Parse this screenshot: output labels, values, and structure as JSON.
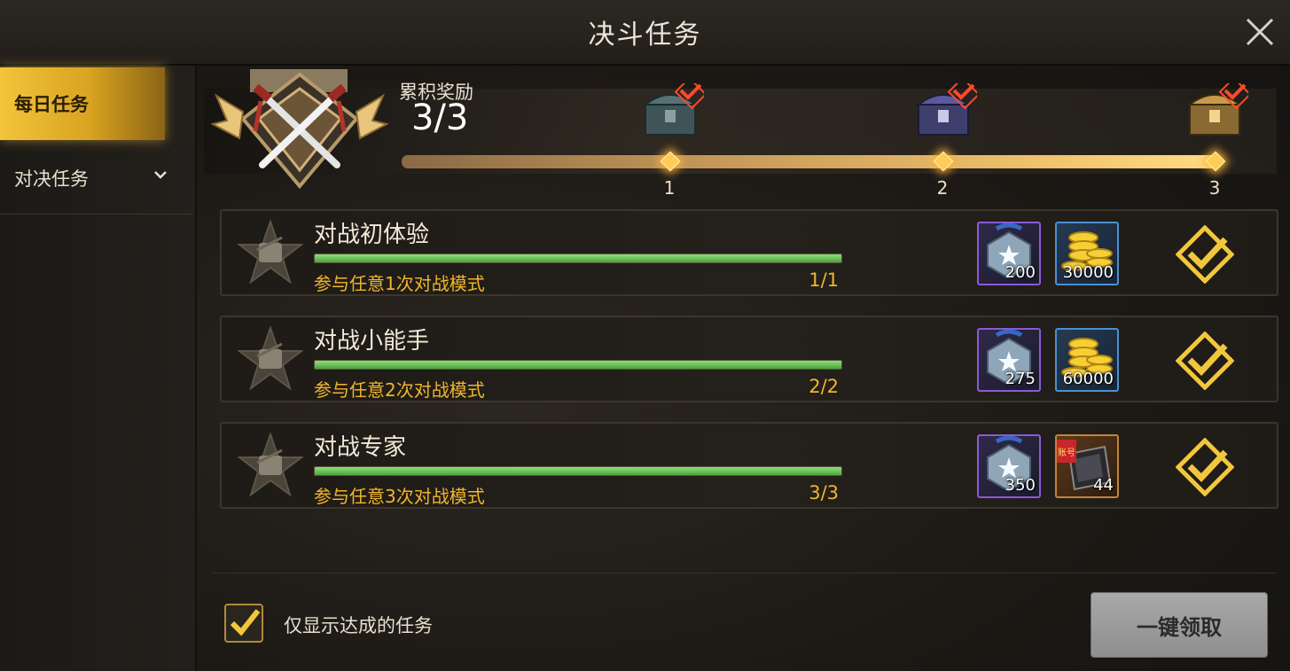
{
  "header": {
    "title": "决斗任务"
  },
  "sidebar": {
    "tabs": [
      {
        "label": "每日任务"
      },
      {
        "label": "对决任务"
      }
    ]
  },
  "rewards": {
    "label": "累积奖励",
    "progress_text": "3/3",
    "progress_fraction": 1.0,
    "milestones": [
      {
        "number": "1",
        "chest": "teal-chest-icon",
        "claimed": true
      },
      {
        "number": "2",
        "chest": "purple-chest-icon",
        "claimed": true
      },
      {
        "number": "3",
        "chest": "gold-chest-icon",
        "claimed": true
      }
    ]
  },
  "tasks": [
    {
      "name": "对战初体验",
      "description": "参与任意1次对战模式",
      "progress": "1/1",
      "fraction": 1.0,
      "rewards": [
        {
          "icon": "crystal-medal-icon",
          "qty": "200"
        },
        {
          "icon": "gold-coins-icon",
          "qty": "30000"
        }
      ],
      "status": "claimed"
    },
    {
      "name": "对战小能手",
      "description": "参与任意2次对战模式",
      "progress": "2/2",
      "fraction": 1.0,
      "rewards": [
        {
          "icon": "crystal-medal-icon",
          "qty": "275"
        },
        {
          "icon": "gold-coins-icon",
          "qty": "60000"
        }
      ],
      "status": "claimed"
    },
    {
      "name": "对战专家",
      "description": "参与任意3次对战模式",
      "progress": "3/3",
      "fraction": 1.0,
      "rewards": [
        {
          "icon": "crystal-medal-icon",
          "qty": "350"
        },
        {
          "icon": "ticket-icon",
          "qty": "44",
          "badge": "账号"
        }
      ],
      "status": "claimed"
    }
  ],
  "footer": {
    "filter_label": "仅显示达成的任务",
    "filter_checked": true,
    "claim_all_label": "一键领取"
  },
  "colors": {
    "accent_gold": "#f0b52a",
    "progress_green": "#6cc457",
    "disabled_button": "#9a9a9a"
  }
}
